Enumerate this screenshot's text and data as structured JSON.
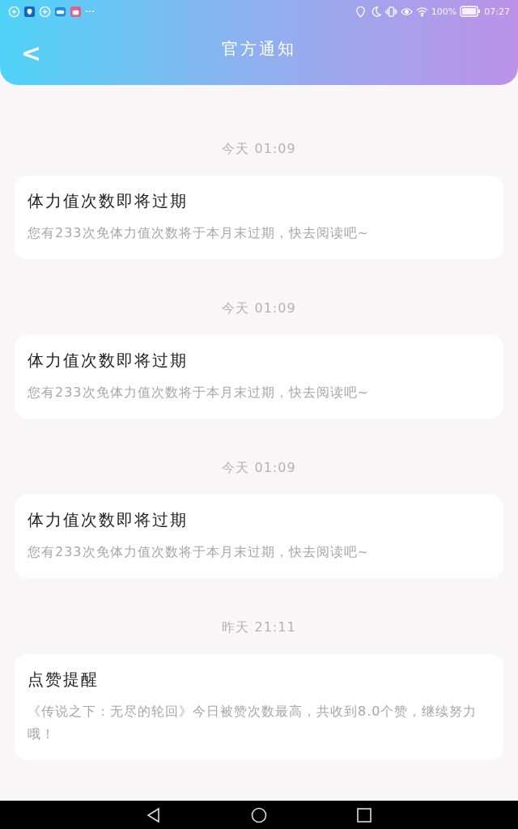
{
  "status_bar": {
    "battery": "100%",
    "time": "07:27"
  },
  "header": {
    "back": "<",
    "title": "官方通知"
  },
  "notifications": [
    {
      "time": "今天 01:09",
      "title": "体力值次数即将过期",
      "body": "您有233次免体力值次数将于本月末过期，快去阅读吧~"
    },
    {
      "time": "今天 01:09",
      "title": "体力值次数即将过期",
      "body": "您有233次免体力值次数将于本月末过期，快去阅读吧~"
    },
    {
      "time": "今天 01:09",
      "title": "体力值次数即将过期",
      "body": "您有233次免体力值次数将于本月末过期，快去阅读吧~"
    },
    {
      "time": "昨天 21:11",
      "title": "点赞提醒",
      "body": "《传说之下：无尽的轮回》今日被赞次数最高，共收到8.0个赞，继续努力哦！"
    }
  ]
}
